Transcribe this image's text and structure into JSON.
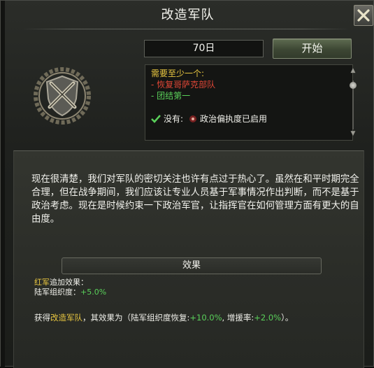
{
  "window": {
    "title": "改造军队"
  },
  "controls": {
    "days": "70日",
    "start_label": "开始"
  },
  "requirements": {
    "header": "需要至少一个:",
    "items": [
      "- 恢复哥萨克部队",
      "- 团结第一"
    ],
    "none_label": "没有:",
    "none_value": "政治偏执度已启用"
  },
  "description": "现在很清楚，我们对军队的密切关注也许有点过于热心了。虽然在和平时期完全合理，但在战争期间，我们应该让专业人员基于军事情况作出判断，而不是基于政治考虑。现在是时候约束一下政治军官，让指挥官在如何管理方面有更大的自由度。",
  "effects": {
    "header": "效果",
    "country": "红军",
    "country_suffix": "追加效果：",
    "line2_label": "陆军组织度：",
    "line2_value": "+5.0%",
    "grant_prefix": "获得",
    "grant_name": "改造军队",
    "grant_mid": "，其效果为（陆军组织度恢复:",
    "grant_v1": "+10.0%",
    "grant_mid2": ", 增援率:",
    "grant_v2": "+2.0%",
    "grant_end": "）。"
  },
  "icons": {
    "close": "close-x-icon",
    "emblem": "crossed-rifles-wreath-icon",
    "check": "check-icon",
    "paranoia": "paranoia-icon"
  },
  "colors": {
    "accent_gold": "#e8c640",
    "negative": "#e04636",
    "positive": "#5ad15a"
  }
}
